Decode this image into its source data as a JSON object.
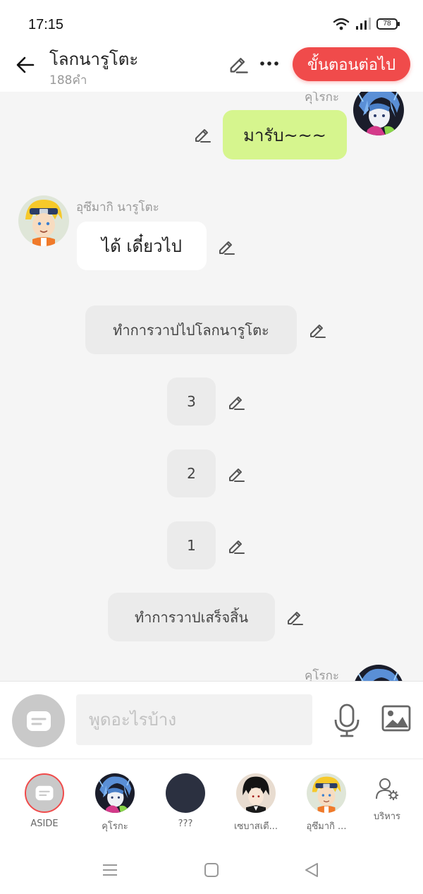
{
  "status": {
    "time": "17:15",
    "battery": "78"
  },
  "header": {
    "title": "โลกนารูโตะ",
    "word_count": "188คำ",
    "next_label": "ขั้นตอนต่อไป"
  },
  "messages": {
    "m1": {
      "sender": "คุโรกะ",
      "text": "มารับ~~~"
    },
    "m2": {
      "sender": "อุซึมากิ นารูโตะ",
      "text": "ได้ เดี๋ยวไป"
    },
    "m3": {
      "text": "ทำการวาปไปโลกนารูโตะ"
    },
    "m4": {
      "text": "3"
    },
    "m5": {
      "text": "2"
    },
    "m6": {
      "text": "1"
    },
    "m7": {
      "text": "ทำการวาปเสร็จสิ้น"
    },
    "m8": {
      "sender": "คุโรกะ"
    }
  },
  "input": {
    "placeholder": "พูดอะไรบ้าง"
  },
  "characters": [
    {
      "label": "ASIDE"
    },
    {
      "label": "คุโรกะ"
    },
    {
      "label": "???"
    },
    {
      "label": "เซบาสเตี..."
    },
    {
      "label": "อุซึมากิ ..."
    }
  ],
  "manage_label": "บริหาร",
  "colors": {
    "accent": "#f04b4b",
    "my_bubble": "#d6f58e",
    "chat_bg": "#f5f5f5"
  }
}
